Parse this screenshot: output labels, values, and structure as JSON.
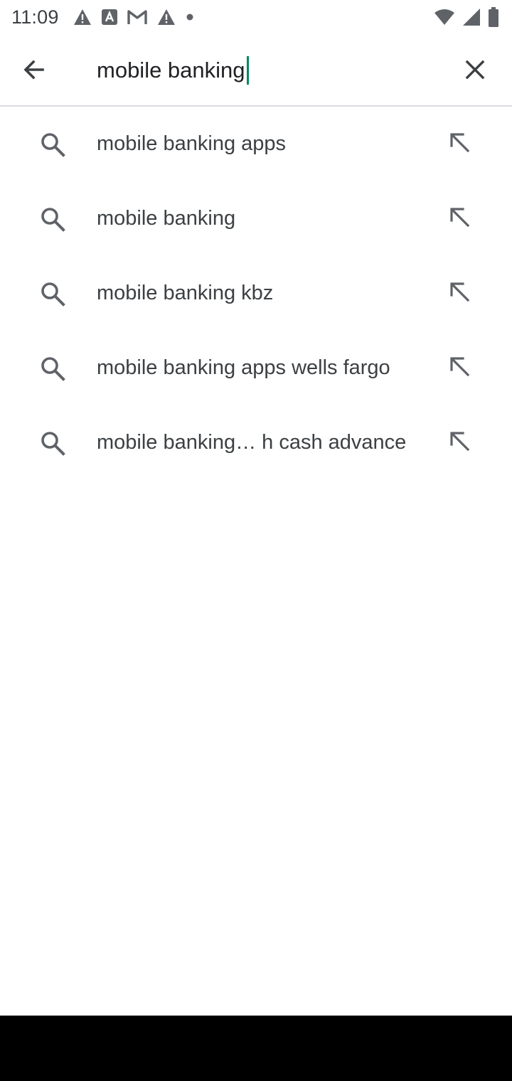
{
  "status_bar": {
    "time": "11:09",
    "icons_left": [
      "alert-icon",
      "text-a-icon",
      "gmail-icon",
      "alert-icon",
      "dot-icon"
    ],
    "icons_right": [
      "wifi-icon",
      "signal-icon",
      "battery-icon"
    ]
  },
  "search": {
    "query": "mobile banking",
    "back_icon": "arrow-left-icon",
    "clear_icon": "close-icon",
    "caret_color": "#01875f"
  },
  "suggestions": [
    {
      "label": "mobile banking apps"
    },
    {
      "label": "mobile banking"
    },
    {
      "label": "mobile banking kbz"
    },
    {
      "label": "mobile banking apps wells fargo"
    },
    {
      "label": "mobile banking… h cash advance"
    }
  ],
  "colors": {
    "text": "#3c4043",
    "icon": "#5f6368",
    "divider": "#dadce0",
    "nav_bar": "#000000"
  }
}
